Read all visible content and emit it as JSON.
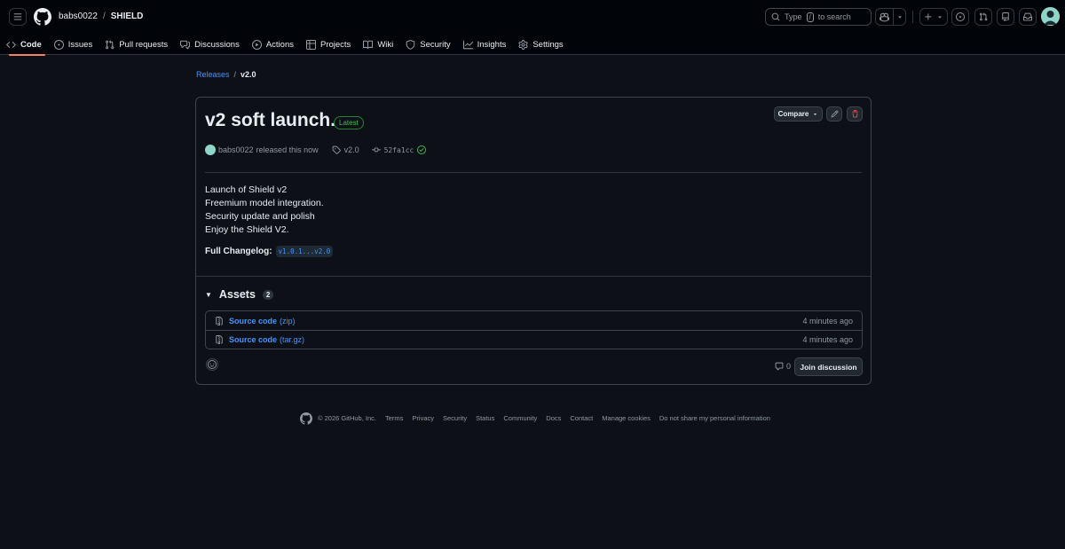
{
  "header": {
    "owner": "babs0022",
    "separator": "/",
    "repo": "SHIELD",
    "search": {
      "label": "Type",
      "key": "/",
      "suffix": "to search"
    }
  },
  "tabs": [
    {
      "label": "Code",
      "icon": "code-icon",
      "active": true
    },
    {
      "label": "Issues",
      "icon": "issue-icon"
    },
    {
      "label": "Pull requests",
      "icon": "pull-request-icon"
    },
    {
      "label": "Discussions",
      "icon": "discussion-icon"
    },
    {
      "label": "Actions",
      "icon": "play-icon"
    },
    {
      "label": "Projects",
      "icon": "table-icon"
    },
    {
      "label": "Wiki",
      "icon": "book-icon"
    },
    {
      "label": "Security",
      "icon": "shield-icon"
    },
    {
      "label": "Insights",
      "icon": "graph-icon"
    },
    {
      "label": "Settings",
      "icon": "gear-icon"
    }
  ],
  "breadcrumb": {
    "parent": "Releases",
    "sep": "/",
    "current": "v2.0"
  },
  "release": {
    "title": "v2 soft launch.",
    "badge": "Latest",
    "compare_label": "Compare",
    "author": "babs0022",
    "released_text": "released this now",
    "tag": "v2.0",
    "commit": "52fa1cc",
    "notes": [
      "Launch of Shield v2",
      "Freemium model integration.",
      "Security update and polish",
      "Enjoy the Shield V2."
    ],
    "changelog_label": "Full Changelog:",
    "changelog_link": "v1.0.1...v2.0"
  },
  "assets": {
    "title": "Assets",
    "count": "2",
    "items": [
      {
        "name": "Source code",
        "ext": "(zip)",
        "time": "4 minutes ago"
      },
      {
        "name": "Source code",
        "ext": "(tar.gz)",
        "time": "4 minutes ago"
      }
    ]
  },
  "discussion": {
    "comment_count": "0",
    "join_label": "Join discussion"
  },
  "footer": {
    "copyright": "© 2026 GitHub, Inc.",
    "links": [
      "Terms",
      "Privacy",
      "Security",
      "Status",
      "Community",
      "Docs",
      "Contact",
      "Manage cookies",
      "Do not share my personal information"
    ]
  },
  "colors": {
    "background": "#0d1117",
    "header_bg": "#010409",
    "link": "#4493f8",
    "border": "#3d444d",
    "latest_green": "#3fb950",
    "delete_red": "#f85149",
    "active_tab_underline": "#f78166"
  }
}
